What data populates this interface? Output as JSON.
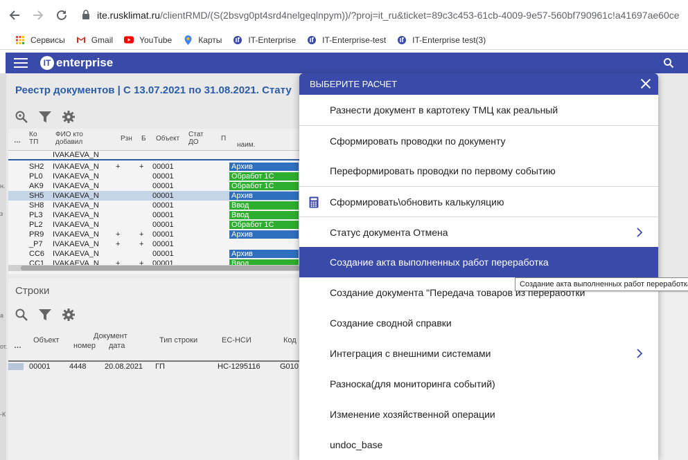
{
  "browser": {
    "url_host": "ite.rusklimat.ru",
    "url_rest": "/clientRMD/(S(2bsvg0pt4srd4nelgeqlnpym))/?proj=it_ru&ticket=89c3c453-61cb-4009-9e57-560bf790961c!a41697ae60ce",
    "bookmarks": [
      {
        "label": "Сервисы",
        "icon": "apps-grid-icon",
        "color": "#ea4335"
      },
      {
        "label": "Gmail",
        "icon": "gmail-icon",
        "color": "#d93025"
      },
      {
        "label": "YouTube",
        "icon": "youtube-icon",
        "color": "#ff0000"
      },
      {
        "label": "Карты",
        "icon": "maps-pin-icon",
        "color": "#34a853"
      },
      {
        "label": "IT-Enterprise",
        "icon": "it-enterprise-icon",
        "color": "#3a4aa8"
      },
      {
        "label": "IT-Enterprise-test",
        "icon": "it-enterprise-icon",
        "color": "#3a4aa8"
      },
      {
        "label": "IT-Enterprise test(3)",
        "icon": "it-enterprise-icon",
        "color": "#3a4aa8"
      }
    ]
  },
  "app": {
    "logo_text": "enterprise",
    "logo_mark": "IT",
    "accent_color": "#3a4aa8"
  },
  "registry": {
    "title": "Реестр документов | С 13.07.2021 по 31.08.2021. Стату",
    "headers": {
      "dots": "…",
      "code": "Ко ТП",
      "fio": "ФИО кто добавил",
      "rzn": "Рзн",
      "b": "Б",
      "object": "Объект",
      "stat": "Стат ДО",
      "p": "П",
      "naim": "наим."
    },
    "filter_value": "IVAKAEVA_N",
    "rows": [
      {
        "code": "SH2",
        "fio": "IVAKAEVA_N",
        "rzn": "+",
        "b": "+",
        "obj": "00001",
        "status": "Архив",
        "kind": "arch"
      },
      {
        "code": "PL0",
        "fio": "IVAKAEVA_N",
        "rzn": "",
        "b": "",
        "obj": "00001",
        "status": "Обработ 1С",
        "kind": "green"
      },
      {
        "code": "AK9",
        "fio": "IVAKAEVA_N",
        "rzn": "",
        "b": "",
        "obj": "00001",
        "status": "Обработ 1С",
        "kind": "green"
      },
      {
        "code": "SH5",
        "fio": "IVAKAEVA_N",
        "rzn": "",
        "b": "",
        "obj": "00001",
        "status": "Архив",
        "kind": "arch",
        "selected": true
      },
      {
        "code": "SH8",
        "fio": "IVAKAEVA_N",
        "rzn": "",
        "b": "",
        "obj": "00001",
        "status": "Ввод",
        "kind": "green"
      },
      {
        "code": "PL3",
        "fio": "IVAKAEVA_N",
        "rzn": "",
        "b": "",
        "obj": "00001",
        "status": "Ввод",
        "kind": "green"
      },
      {
        "code": "PL2",
        "fio": "IVAKAEVA_N",
        "rzn": "",
        "b": "",
        "obj": "00001",
        "status": "Обработ 1С",
        "kind": "green"
      },
      {
        "code": "PR9",
        "fio": "IVAKAEVA_N",
        "rzn": "+",
        "b": "+",
        "obj": "00001",
        "status": "Архив",
        "kind": "arch"
      },
      {
        "code": "_P7",
        "fio": "IVAKAEVA_N",
        "rzn": "+",
        "b": "+",
        "obj": "00001",
        "status": "",
        "kind": "none"
      },
      {
        "code": "CC6",
        "fio": "IVAKAEVA_N",
        "rzn": "",
        "b": "",
        "obj": "00001",
        "status": "Архив",
        "kind": "arch"
      },
      {
        "code": "CC1",
        "fio": "IVAKAEVA_N",
        "rzn": "+",
        "b": "+",
        "obj": "00001",
        "status": "Ввод",
        "kind": "green"
      }
    ]
  },
  "lines": {
    "title": "Строки",
    "headers": {
      "dots": "…",
      "object": "Объект",
      "document": "Документ",
      "number": "номер",
      "date": "дата",
      "row_type": "Тип строки",
      "ec_nsi": "ЕС-НСИ",
      "code": "Код"
    },
    "row": {
      "object": "00001",
      "number": "4448",
      "date": "20.08.2021",
      "row_type": "ГП",
      "ec_nsi": "НС-1295116",
      "code": "G010"
    }
  },
  "dialog": {
    "title": "ВЫБЕРИТЕ РАСЧЕТ",
    "items": [
      {
        "label": "Разнести документ в картотеку ТМЦ как реальный",
        "sep": false
      },
      {
        "label": "Сформировать проводки по документу",
        "sep": true
      },
      {
        "label": "Переформировать проводки по первому событию",
        "sep": false
      },
      {
        "label": "Сформировать\\обновить калькуляцию",
        "sep": true,
        "icon": "calculator-icon"
      },
      {
        "label": "Статус документа Отмена",
        "sep": true,
        "submenu": true
      },
      {
        "label": "Создание акта выполненных работ переработка",
        "sep": false,
        "active": true
      },
      {
        "label": "Создание документа \"Передача товаров из переработки",
        "sep": false
      },
      {
        "label": "Создание сводной справки",
        "sep": false
      },
      {
        "label": "Интеграция с внешними системами",
        "sep": false,
        "submenu": true
      },
      {
        "label": "Разноска(для мониторинга событий)",
        "sep": false
      },
      {
        "label": "Изменение хозяйственной операции",
        "sep": false
      },
      {
        "label": "undoc_base",
        "sep": false
      }
    ]
  },
  "tooltip": "Создание акта выполненных работ переработка"
}
